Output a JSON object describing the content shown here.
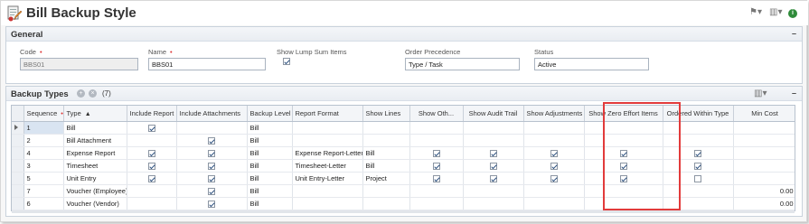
{
  "header": {
    "title": "Bill Backup Style",
    "status_icon": "i"
  },
  "general": {
    "title": "General",
    "collapse": "–",
    "fields": {
      "code_label": "Code",
      "code_value": "BBS01",
      "name_label": "Name",
      "name_value": "BBS01",
      "lump_label": "Show Lump Sum Items",
      "lump_checked": true,
      "order_label": "Order Precedence",
      "order_value": "Type / Task",
      "status_label": "Status",
      "status_value": "Active"
    }
  },
  "backup": {
    "title": "Backup Types",
    "count": "(7)",
    "collapse": "–",
    "columns": [
      "Sequence",
      "Type",
      "Include Report",
      "Include Attachments",
      "Backup Level",
      "Report Format",
      "Show Lines",
      "Show Oth...",
      "Show Audit Trail",
      "Show Adjustments",
      "Show Zero Effort Items",
      "Ordered Within Type",
      "Min Cost"
    ],
    "rows": [
      {
        "seq": "1",
        "type": "Bill",
        "inc_report": true,
        "inc_attach": false,
        "level": "Bill",
        "format": "",
        "lines": "",
        "other": false,
        "audit": false,
        "adjust": false,
        "zero": false,
        "ordered": "none",
        "min_cost": ""
      },
      {
        "seq": "2",
        "type": "Bill Attachment",
        "inc_report": false,
        "inc_attach": true,
        "level": "Bill",
        "format": "",
        "lines": "",
        "other": false,
        "audit": false,
        "adjust": false,
        "zero": false,
        "ordered": "none",
        "min_cost": ""
      },
      {
        "seq": "4",
        "type": "Expense Report",
        "inc_report": true,
        "inc_attach": true,
        "level": "Bill",
        "format": "Expense Report-Letter",
        "lines": "Bill",
        "other": true,
        "audit": true,
        "adjust": true,
        "zero": true,
        "ordered": "checked",
        "min_cost": ""
      },
      {
        "seq": "3",
        "type": "Timesheet",
        "inc_report": true,
        "inc_attach": true,
        "level": "Bill",
        "format": "Timesheet-Letter",
        "lines": "Bill",
        "other": true,
        "audit": true,
        "adjust": true,
        "zero": true,
        "ordered": "checked",
        "min_cost": ""
      },
      {
        "seq": "5",
        "type": "Unit Entry",
        "inc_report": true,
        "inc_attach": true,
        "level": "Bill",
        "format": "Unit Entry-Letter",
        "lines": "Project",
        "other": true,
        "audit": true,
        "adjust": true,
        "zero": true,
        "ordered": "unchecked",
        "min_cost": ""
      },
      {
        "seq": "7",
        "type": "Voucher (Employee)",
        "inc_report": false,
        "inc_attach": true,
        "level": "Bill",
        "format": "",
        "lines": "",
        "other": false,
        "audit": false,
        "adjust": false,
        "zero": false,
        "ordered": "none",
        "min_cost": "0.00"
      },
      {
        "seq": "6",
        "type": "Voucher (Vendor)",
        "inc_report": false,
        "inc_attach": true,
        "level": "Bill",
        "format": "",
        "lines": "",
        "other": false,
        "audit": false,
        "adjust": false,
        "zero": false,
        "ordered": "none",
        "min_cost": "0.00"
      }
    ]
  },
  "colors": {
    "highlight": "#e23b3b",
    "panel_border": "#c9d2dc",
    "status_green": "#2f8b3a"
  }
}
